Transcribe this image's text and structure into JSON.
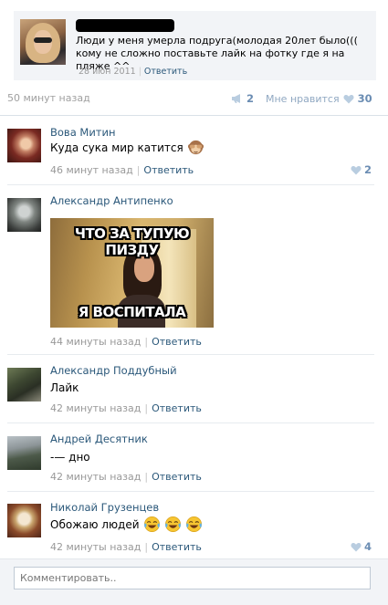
{
  "post": {
    "text": "Люди у меня умерла подруга(молодая 20лет было(((\nкому не сложно поставьте лайк на фотку где я на пляже ^^",
    "date": "28 июн 2011",
    "reply_label": "Ответить"
  },
  "stats": {
    "time": "50 минут назад",
    "shares": "2",
    "like_label": "Мне нравится",
    "likes": "30"
  },
  "comments": [
    {
      "author": "Вова Митин",
      "text": "Куда сука мир катится",
      "time": "46 минут назад",
      "reply": "Ответить",
      "likes": "2"
    },
    {
      "author": "Александр Антипенко",
      "time": "44 минуты назад",
      "reply": "Ответить",
      "meme_top": "ЧТО ЗА ТУПУЮ ПИЗДУ",
      "meme_bottom": "Я ВОСПИТАЛА"
    },
    {
      "author": "Александр Поддубный",
      "text": "Лайк",
      "time": "42 минуты назад",
      "reply": "Ответить"
    },
    {
      "author": "Андрей Десятник",
      "text": "-— дно",
      "time": "42 минуты назад",
      "reply": "Ответить"
    },
    {
      "author": "Николай Грузенцев",
      "text": "Обожаю людей",
      "time": "42 минуты назад",
      "reply": "Ответить",
      "likes": "4"
    }
  ],
  "composer": {
    "placeholder": "Комментировать.."
  },
  "colors": {
    "link": "#2b587a",
    "muted": "#999999",
    "like_blue": "#6b8db3",
    "heart": "#b9cde0"
  },
  "icons": [
    "share-megaphone-icon",
    "heart-icon",
    "see-no-evil-monkey-emoji",
    "tears-of-joy-emoji"
  ]
}
